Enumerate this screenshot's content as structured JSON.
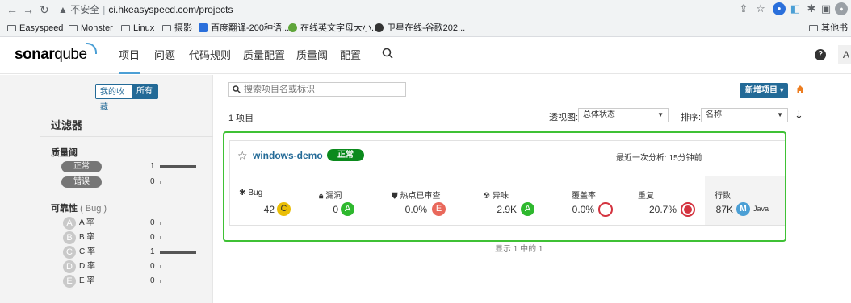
{
  "browser": {
    "security_label": "不安全",
    "url": "ci.hkeasyspeed.com/projects",
    "bookmarks": [
      "Easyspeed",
      "Monster",
      "Linux",
      "摄影",
      "百度翻译-200种语...",
      "在线英文字母大小...",
      "卫星在线-谷歌202..."
    ],
    "other_bookmarks": "其他书"
  },
  "nav": {
    "logo_pre": "sonar",
    "logo_post": "qube",
    "items": [
      "项目",
      "问题",
      "代码规则",
      "质量配置",
      "质量阈",
      "配置"
    ],
    "avatar": "A"
  },
  "sidebar": {
    "fav_label": "我的收藏",
    "all_label": "所有",
    "filters_title": "过滤器",
    "quality_gate": {
      "title": "质量阈",
      "items": [
        {
          "label": "正常",
          "count": "1",
          "fill": 1.0
        },
        {
          "label": "错误",
          "count": "0",
          "fill": 0.0
        }
      ]
    },
    "reliability": {
      "title": "可靠性",
      "sub": "( Bug )",
      "items": [
        {
          "grade": "A",
          "label": "A 率",
          "count": "0",
          "fill": 0.0,
          "color": "#c9c9c9"
        },
        {
          "grade": "B",
          "label": "B 率",
          "count": "0",
          "fill": 0.0,
          "color": "#c9c9c9"
        },
        {
          "grade": "C",
          "label": "C 率",
          "count": "1",
          "fill": 1.0,
          "color": "#c9c9c9"
        },
        {
          "grade": "D",
          "label": "D 率",
          "count": "0",
          "fill": 0.0,
          "color": "#c9c9c9"
        },
        {
          "grade": "E",
          "label": "E 率",
          "count": "0",
          "fill": 0.0,
          "color": "#c9c9c9"
        }
      ]
    }
  },
  "main": {
    "search_placeholder": "搜索项目名或标识",
    "new_project": "新增项目",
    "project_count": "1 项目",
    "perspective_label": "透视图:",
    "perspective_value": "总体状态",
    "sort_label": "排序:",
    "sort_value": "名称",
    "pagination": "显示 1 中的 1"
  },
  "project": {
    "name": "windows-demo",
    "status": "正常",
    "last_analysis": "最近一次分析: 15分钟前",
    "metrics": {
      "bugs": {
        "label": "Bug",
        "value": "42",
        "rating": "C"
      },
      "vulnerabilities": {
        "label": "漏洞",
        "value": "0",
        "rating": "A"
      },
      "hotspots": {
        "label": "热点已审查",
        "value": "0.0%",
        "rating": "E"
      },
      "code_smells": {
        "label": "异味",
        "value": "2.9K",
        "rating": "A"
      },
      "coverage": {
        "label": "覆盖率",
        "value": "0.0%"
      },
      "duplications": {
        "label": "重复",
        "value": "20.7%"
      },
      "lines": {
        "label": "行数",
        "value": "87K",
        "lang_badge": "M",
        "language": "Java"
      }
    }
  },
  "colors": {
    "accent": "#236a97",
    "status_ok": "#0b8a1d",
    "highlight_frame": "#3fc135"
  }
}
